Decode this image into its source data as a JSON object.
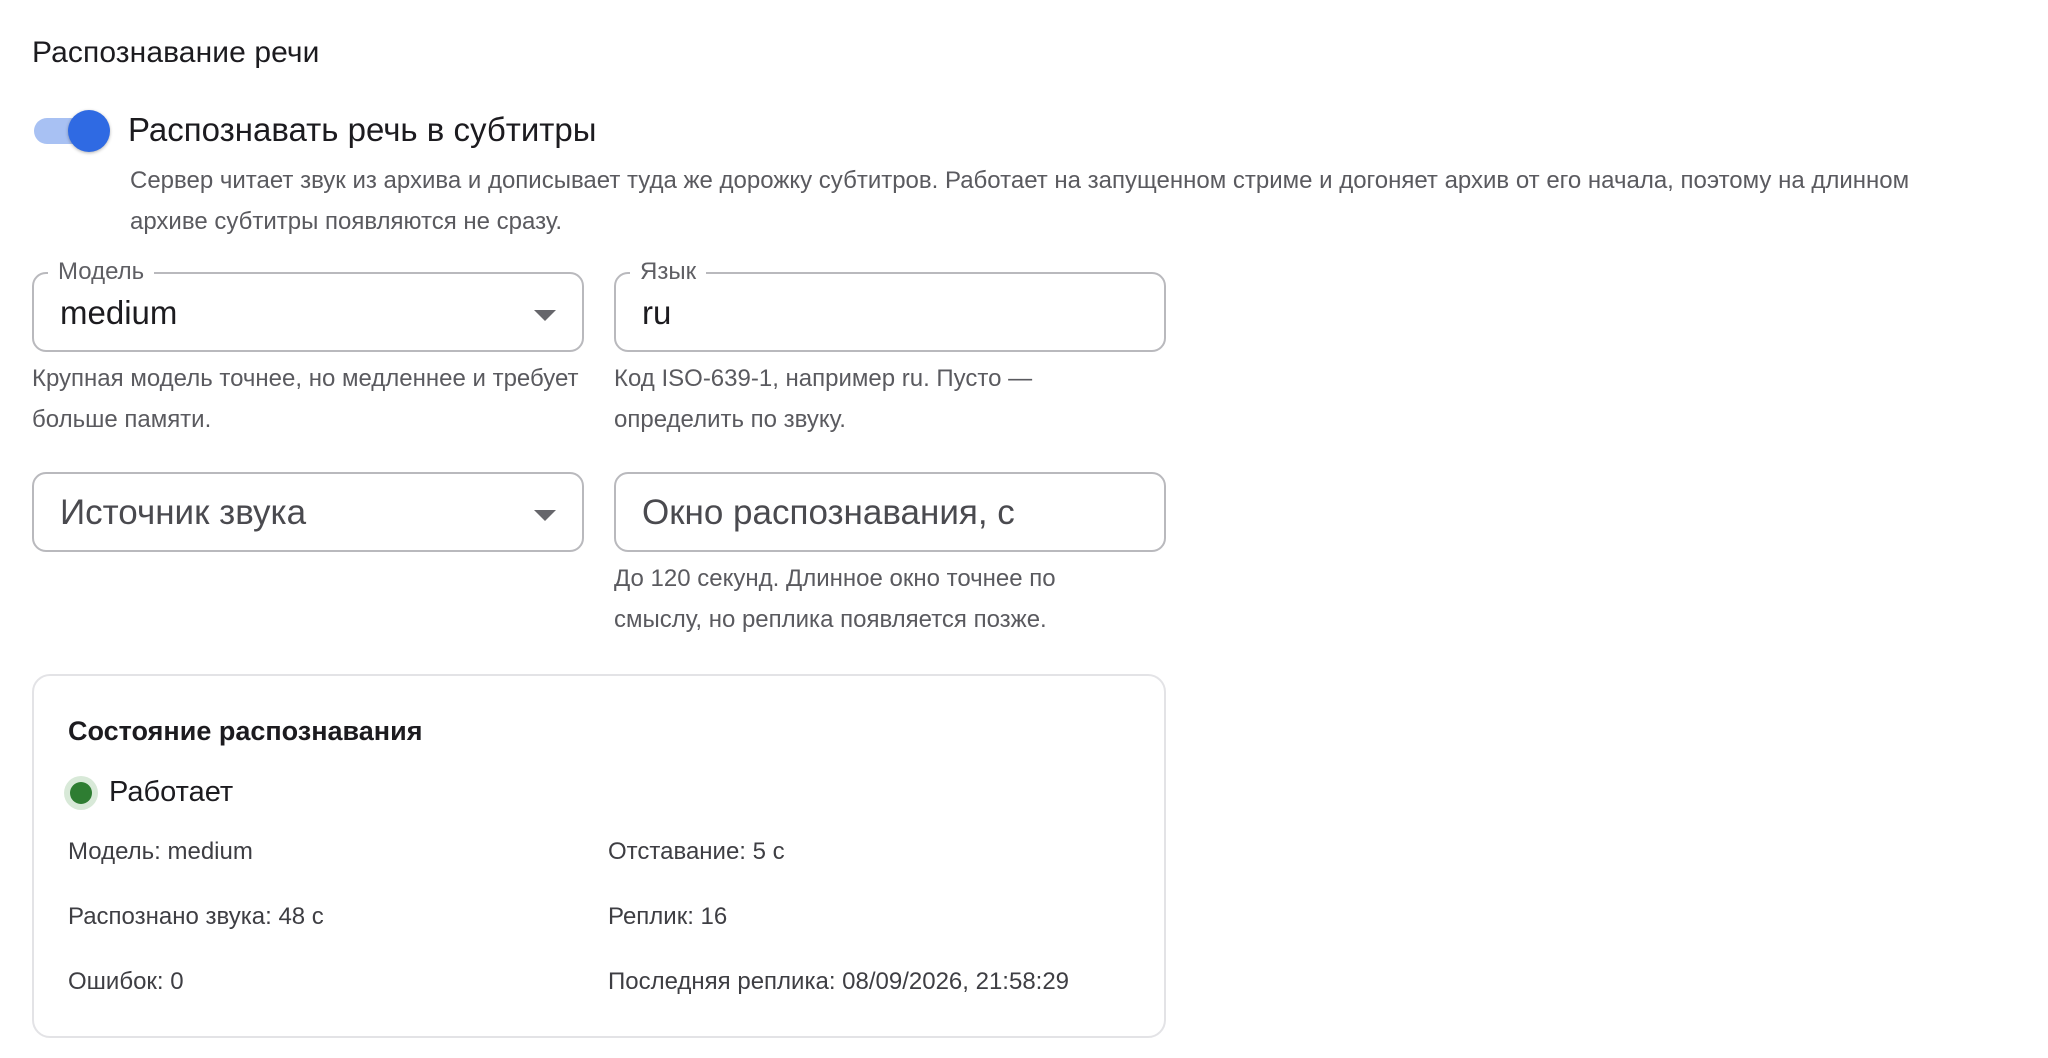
{
  "section": {
    "title": "Распознавание речи"
  },
  "toggle": {
    "label": "Распознавать речь в субтитры",
    "checked": true,
    "description": "Сервер читает звук из архива и дописывает туда же дорожку субтитров. Работает на запущенном стриме и догоняет архив от его начала, поэтому на длинном архиве субтитры появляются не сразу."
  },
  "fields": {
    "model": {
      "label": "Модель",
      "value": "medium",
      "helper": "Крупная модель точнее, но медленнее и требует больше памяти."
    },
    "language": {
      "label": "Язык",
      "value": "ru",
      "helper": "Код ISO-639-1, например ru. Пусто — определить по звуку."
    },
    "audio_source": {
      "placeholder": "Источник звука"
    },
    "window": {
      "placeholder": "Окно распознавания, с",
      "helper": "До 120 секунд. Длинное окно точнее по смыслу, но реплика появляется позже."
    }
  },
  "status_card": {
    "title": "Состояние распознавания",
    "status": "Работает",
    "status_color": "#2e7d32",
    "stats": {
      "model": "Модель: medium",
      "lag": "Отставание: 5 с",
      "recognized": "Распознано звука: 48 с",
      "replicas": "Реплик: 16",
      "errors": "Ошибок: 0",
      "last_replica": "Последняя реплика: 08/09/2026, 21:58:29"
    }
  },
  "colors": {
    "accent": "#2f6ae3",
    "accent_track": "#a8c1f3",
    "success": "#2e7d32"
  }
}
